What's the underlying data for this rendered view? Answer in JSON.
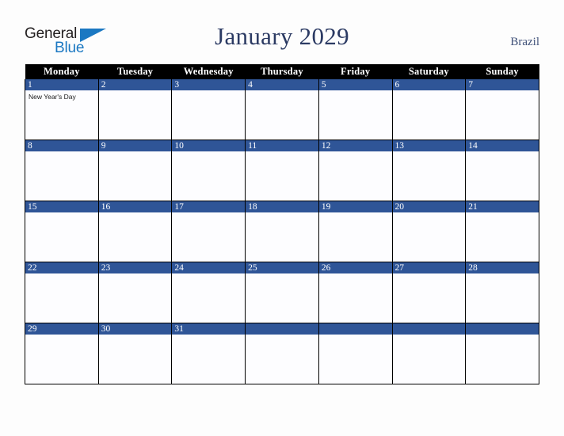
{
  "brand": {
    "name_part1": "General",
    "name_part2": "Blue",
    "triangle_icon": "triangle-icon",
    "accent_color": "#1b78c2"
  },
  "header": {
    "title": "January 2029",
    "region": "Brazil",
    "title_color": "#2b3a63"
  },
  "calendar": {
    "header_background": "#000000",
    "daynum_background": "#2f5597",
    "weekday_headers": [
      "Monday",
      "Tuesday",
      "Wednesday",
      "Thursday",
      "Friday",
      "Saturday",
      "Sunday"
    ],
    "weeks": [
      [
        {
          "date": "1",
          "events": [
            "New Year's Day"
          ]
        },
        {
          "date": "2",
          "events": []
        },
        {
          "date": "3",
          "events": []
        },
        {
          "date": "4",
          "events": []
        },
        {
          "date": "5",
          "events": []
        },
        {
          "date": "6",
          "events": []
        },
        {
          "date": "7",
          "events": []
        }
      ],
      [
        {
          "date": "8",
          "events": []
        },
        {
          "date": "9",
          "events": []
        },
        {
          "date": "10",
          "events": []
        },
        {
          "date": "11",
          "events": []
        },
        {
          "date": "12",
          "events": []
        },
        {
          "date": "13",
          "events": []
        },
        {
          "date": "14",
          "events": []
        }
      ],
      [
        {
          "date": "15",
          "events": []
        },
        {
          "date": "16",
          "events": []
        },
        {
          "date": "17",
          "events": []
        },
        {
          "date": "18",
          "events": []
        },
        {
          "date": "19",
          "events": []
        },
        {
          "date": "20",
          "events": []
        },
        {
          "date": "21",
          "events": []
        }
      ],
      [
        {
          "date": "22",
          "events": []
        },
        {
          "date": "23",
          "events": []
        },
        {
          "date": "24",
          "events": []
        },
        {
          "date": "25",
          "events": []
        },
        {
          "date": "26",
          "events": []
        },
        {
          "date": "27",
          "events": []
        },
        {
          "date": "28",
          "events": []
        }
      ],
      [
        {
          "date": "29",
          "events": []
        },
        {
          "date": "30",
          "events": []
        },
        {
          "date": "31",
          "events": []
        },
        {
          "date": "",
          "events": []
        },
        {
          "date": "",
          "events": []
        },
        {
          "date": "",
          "events": []
        },
        {
          "date": "",
          "events": []
        }
      ]
    ]
  }
}
